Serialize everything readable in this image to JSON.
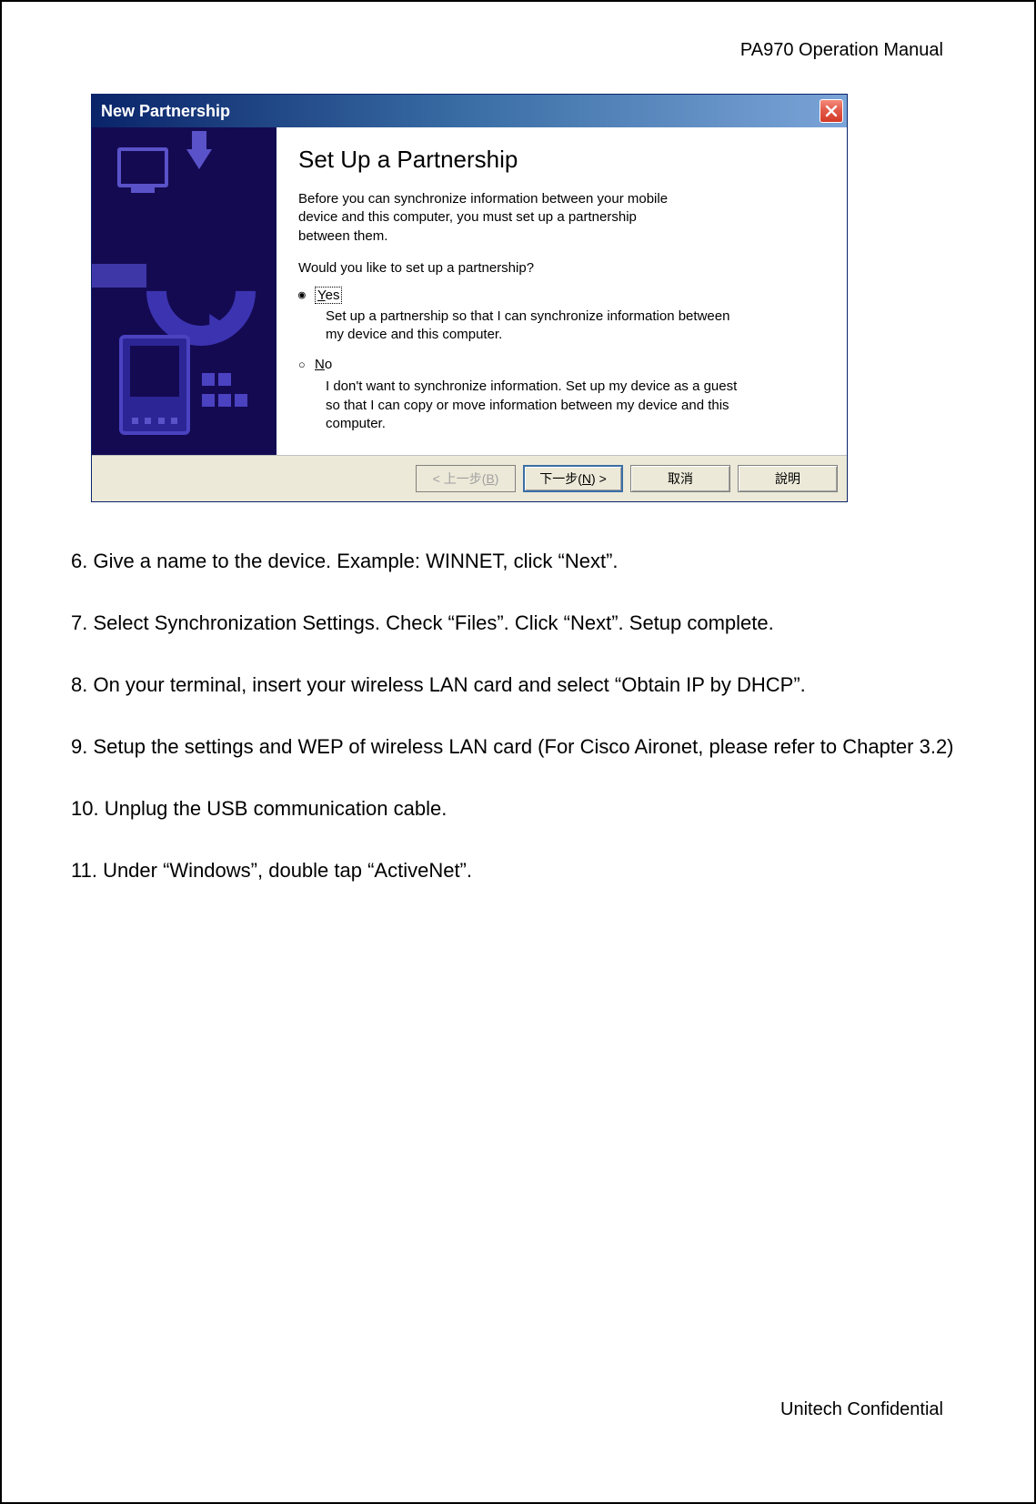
{
  "doc": {
    "header": "PA970 Operation Manual",
    "footer": "Unitech Confidential"
  },
  "dialog": {
    "title": "New Partnership",
    "heading": "Set Up a Partnership",
    "description": "Before you can synchronize information between your mobile device and this computer, you must set up a partnership between them.",
    "question": "Would you like to set up a partnership?",
    "options": {
      "yes": {
        "label_pre": "Y",
        "label_rest": "es",
        "sub": "Set up a partnership so that I can synchronize information between my device and this computer."
      },
      "no": {
        "label_pre": "N",
        "label_rest": "o",
        "sub": "I don't want to synchronize information. Set up my device as a guest so that I can copy or move information between my device and this computer."
      }
    },
    "buttons": {
      "back_pre": "< 上一步(",
      "back_u": "B",
      "back_post": ")",
      "next_pre": "下一步(",
      "next_u": "N",
      "next_post": ") >",
      "cancel": "取消",
      "help": "說明"
    }
  },
  "steps": {
    "s6": "6. Give a name to the device. Example: WINNET, click “Next”.",
    "s7": "7. Select Synchronization Settings. Check “Files”. Click “Next”. Setup complete.",
    "s8": "8. On your terminal, insert your wireless LAN card and select “Obtain IP by DHCP”.",
    "s9": "9. Setup the settings and WEP of wireless LAN card (For Cisco Aironet, please refer to Chapter 3.2)",
    "s10": "10. Unplug the USB communication cable.",
    "s11": "11. Under “Windows”, double tap “ActiveNet”."
  }
}
